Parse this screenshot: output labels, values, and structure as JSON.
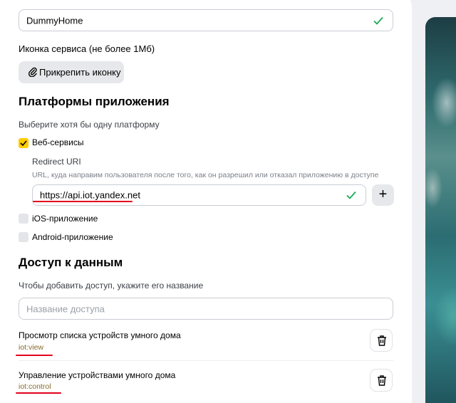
{
  "app_name_field": {
    "value": "DummyHome"
  },
  "service_icon": {
    "label": "Иконка сервиса (не более 1Мб)",
    "attach_button": "Прикрепить иконку"
  },
  "platforms": {
    "title": "Платформы приложения",
    "hint": "Выберите хотя бы одну платформу",
    "web": {
      "label": "Веб-сервисы",
      "checked": true
    },
    "redirect": {
      "label": "Redirect URI",
      "hint": "URL, куда направим пользователя после того, как он разрешил или отказал приложению в доступе",
      "value": "https://api.iot.yandex.net",
      "add_symbol": "+"
    },
    "ios": {
      "label": "iOS-приложение",
      "checked": false
    },
    "android": {
      "label": "Android-приложение",
      "checked": false
    }
  },
  "data_access": {
    "title": "Доступ к данным",
    "hint": "Чтобы добавить доступ, укажите его название",
    "search_placeholder": "Название доступа",
    "items": [
      {
        "title": "Просмотр списка устройств умного дома",
        "scope": "iot:view"
      },
      {
        "title": "Управление устройствами умного дома",
        "scope": "iot:control"
      }
    ]
  },
  "colors": {
    "accent": "#ffcc00",
    "check": "#1aaa55",
    "annotation": "#e3001b"
  }
}
